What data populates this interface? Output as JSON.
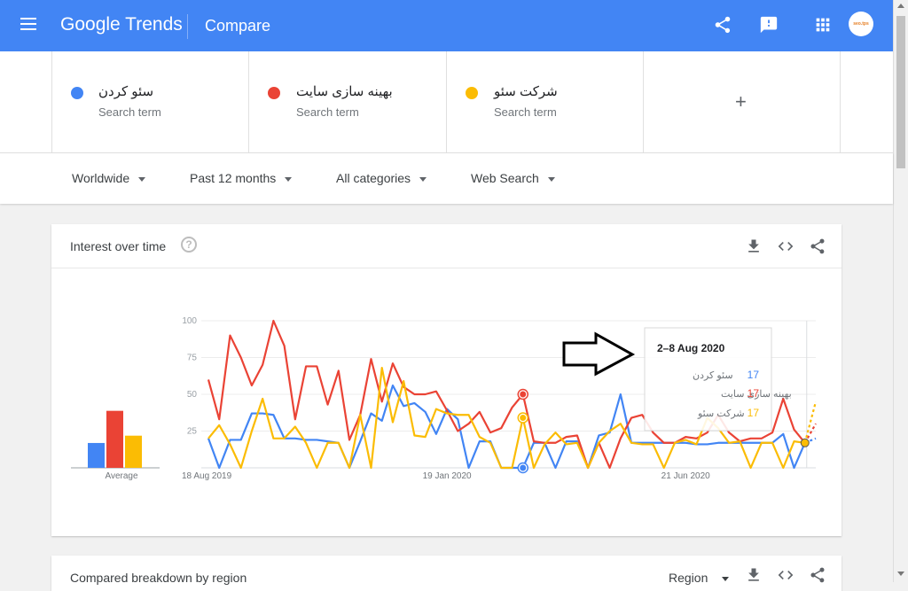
{
  "header": {
    "logo": "Google Trends",
    "title": "Compare",
    "avatar_text": "seo.tps"
  },
  "terms": [
    {
      "name": "سئو کردن",
      "sub": "Search term",
      "color": "#4285f4"
    },
    {
      "name": "بهینه سازی سایت",
      "sub": "Search term",
      "color": "#ea4335"
    },
    {
      "name": "شرکت سئو",
      "sub": "Search term",
      "color": "#fbbc04"
    }
  ],
  "add_term": "+",
  "filters": {
    "region": "Worldwide",
    "time": "Past 12 months",
    "category": "All categories",
    "search_type": "Web Search"
  },
  "card": {
    "title": "Interest over time",
    "help": "?"
  },
  "card2": {
    "title": "Compared breakdown by region",
    "dropdown": "Region"
  },
  "average_label": "Average",
  "tooltip": {
    "date": "2–8 Aug 2020",
    "rows": [
      {
        "name": "سئو کردن",
        "value": "17",
        "color": "#4285f4"
      },
      {
        "name": "بهینه سازی سایت",
        "value": "17",
        "color": "#ea4335"
      },
      {
        "name": "شرکت سئو",
        "value": "17",
        "color": "#fbbc04"
      }
    ]
  },
  "chart_data": {
    "type": "line",
    "y_ticks": [
      "100",
      "75",
      "50",
      "25"
    ],
    "ylim": [
      0,
      100
    ],
    "x_tick_labels": [
      {
        "label": "18 Aug 2019",
        "index": 0
      },
      {
        "label": "19 Jan 2020",
        "index": 22
      },
      {
        "label": "21 Jun 2020",
        "index": 44
      }
    ],
    "highlight_index": 29,
    "averages": [
      17,
      39,
      22
    ],
    "series": [
      {
        "name": "سئو کردن",
        "color": "#4285f4",
        "values": [
          20,
          0,
          19,
          19,
          37,
          37,
          36,
          20,
          20,
          19,
          19,
          18,
          17,
          0,
          18,
          37,
          32,
          56,
          42,
          44,
          38,
          23,
          40,
          33,
          0,
          18,
          18,
          0,
          0,
          0,
          17,
          17,
          0,
          18,
          18,
          0,
          22,
          24,
          50,
          17,
          17,
          17,
          17,
          17,
          17,
          16,
          16,
          17,
          17,
          17,
          17,
          17,
          17,
          23,
          0,
          17,
          20
        ]
      },
      {
        "name": "بهینه سازی سایت",
        "color": "#ea4335",
        "values": [
          60,
          33,
          90,
          75,
          56,
          70,
          100,
          83,
          33,
          69,
          69,
          43,
          66,
          19,
          36,
          74,
          45,
          71,
          55,
          50,
          50,
          52,
          39,
          25,
          30,
          38,
          24,
          27,
          41,
          50,
          18,
          17,
          17,
          21,
          22,
          0,
          17,
          0,
          20,
          34,
          36,
          24,
          17,
          17,
          21,
          20,
          24,
          36,
          24,
          18,
          20,
          20,
          24,
          47,
          26,
          17,
          30
        ]
      },
      {
        "name": "شرکت سئو",
        "color": "#fbbc04",
        "values": [
          20,
          29,
          16,
          0,
          25,
          47,
          20,
          20,
          28,
          17,
          0,
          17,
          17,
          0,
          36,
          0,
          68,
          31,
          59,
          22,
          21,
          40,
          37,
          36,
          36,
          21,
          17,
          0,
          0,
          34,
          0,
          16,
          24,
          16,
          17,
          0,
          17,
          25,
          30,
          17,
          16,
          16,
          0,
          17,
          19,
          16,
          34,
          27,
          17,
          18,
          0,
          17,
          17,
          0,
          18,
          17,
          45
        ]
      }
    ]
  }
}
